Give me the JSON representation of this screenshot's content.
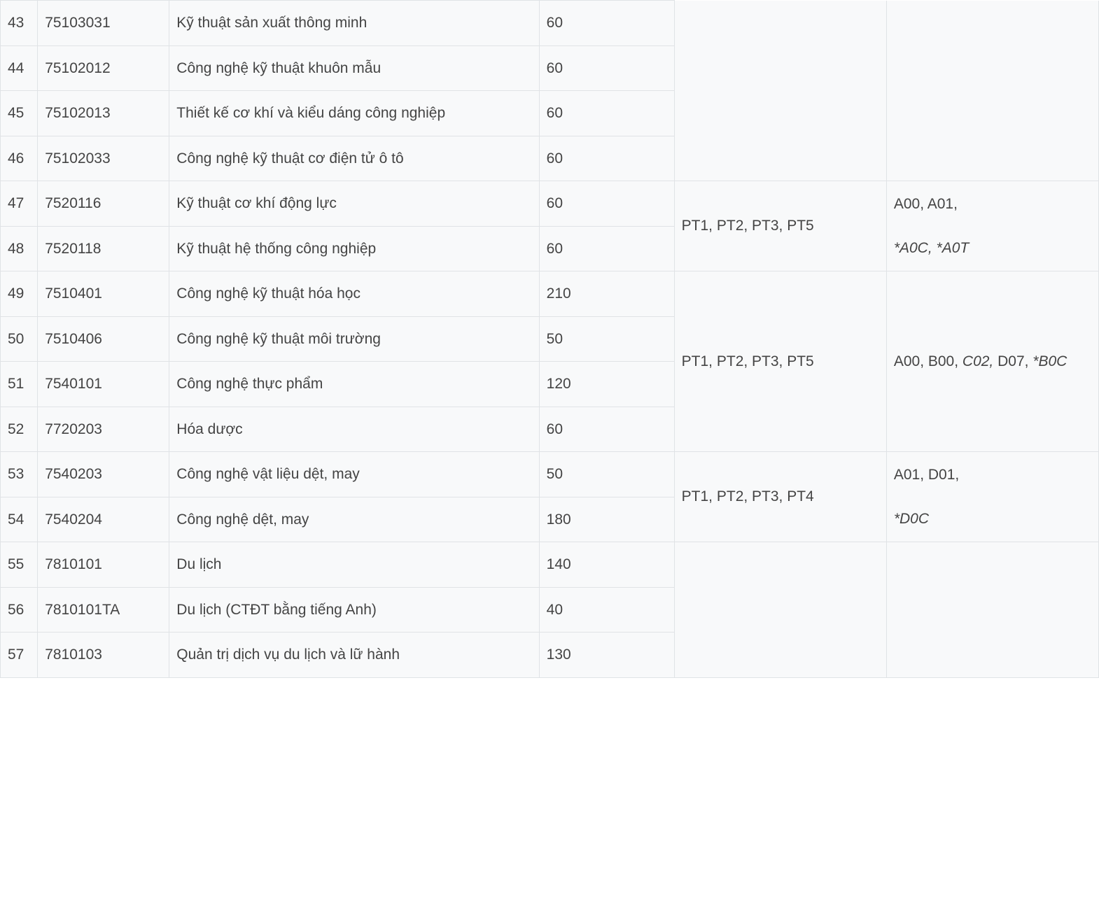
{
  "rows": [
    {
      "idx": "43",
      "code": "75103031",
      "name": "Kỹ thuật sản xuất thông minh",
      "qty": "60"
    },
    {
      "idx": "44",
      "code": "75102012",
      "name": "Công nghệ kỹ thuật khuôn mẫu",
      "qty": "60"
    },
    {
      "idx": "45",
      "code": "75102013",
      "name": "Thiết kế cơ khí và kiểu dáng công nghiệp",
      "qty": "60"
    },
    {
      "idx": "46",
      "code": "75102033",
      "name": "Công nghệ kỹ thuật cơ điện tử ô tô",
      "qty": "60"
    },
    {
      "idx": "47",
      "code": "7520116",
      "name": "Kỹ thuật cơ khí động lực",
      "qty": "60"
    },
    {
      "idx": "48",
      "code": "7520118",
      "name": "Kỹ thuật hệ thống công nghiệp",
      "qty": "60"
    },
    {
      "idx": "49",
      "code": "7510401",
      "name": "Công nghệ kỹ thuật hóa học",
      "qty": "210"
    },
    {
      "idx": "50",
      "code": "7510406",
      "name": "Công nghệ kỹ thuật môi trường",
      "qty": "50"
    },
    {
      "idx": "51",
      "code": "7540101",
      "name": "Công nghệ thực phẩm",
      "qty": "120"
    },
    {
      "idx": "52",
      "code": "7720203",
      "name": "Hóa dược",
      "qty": "60"
    },
    {
      "idx": "53",
      "code": "7540203",
      "name": "Công nghệ vật liệu dệt, may",
      "qty": "50"
    },
    {
      "idx": "54",
      "code": "7540204",
      "name": "Công nghệ dệt, may",
      "qty": "180"
    },
    {
      "idx": "55",
      "code": "7810101",
      "name": "Du lịch",
      "qty": "140"
    },
    {
      "idx": "56",
      "code": "7810101TA",
      "name": "Du lịch (CTĐT bằng tiếng Anh)",
      "qty": "40"
    },
    {
      "idx": "57",
      "code": "7810103",
      "name": "Quản trị dịch vụ du lịch và lữ hành",
      "qty": "130"
    }
  ],
  "groups": {
    "g1": {
      "pt": "",
      "sub_plain": "",
      "sub_ital": ""
    },
    "g2": {
      "pt": "PT1, PT2, PT3, PT5",
      "sub_plain": "A00, A01,",
      "sub_ital": "*A0C, *A0T"
    },
    "g3": {
      "pt": "PT1, PT2, PT3, PT5",
      "sub_plain": "A00, B00, ",
      "sub_mid_ital": "C02,",
      "sub_plain2": " D07, ",
      "sub_ital": "*B0C"
    },
    "g4": {
      "pt": "PT1, PT2, PT3, PT4",
      "sub_plain": "A01, D01,",
      "sub_ital": "*D0C"
    },
    "g5": {
      "pt": "",
      "sub_plain": "",
      "sub_ital": ""
    }
  }
}
